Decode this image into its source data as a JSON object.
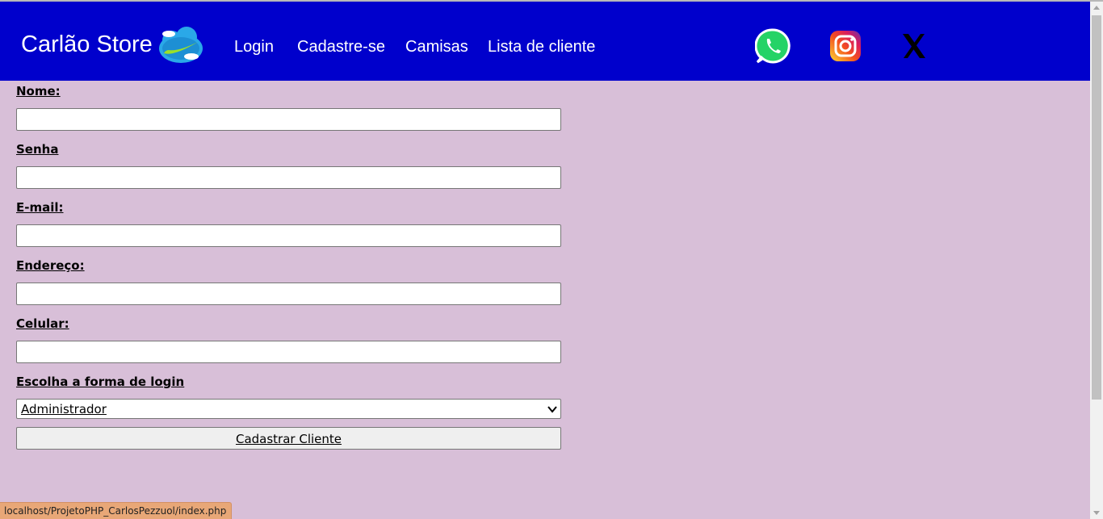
{
  "header": {
    "brand": "Carlão Store",
    "nav": [
      {
        "label": "Login"
      },
      {
        "label": "Cadastre-se"
      },
      {
        "label": "Camisas"
      },
      {
        "label": "Lista de cliente"
      }
    ],
    "social": [
      "whatsapp-icon",
      "instagram-icon",
      "x-icon"
    ]
  },
  "form": {
    "fields": [
      {
        "label": "Nome:",
        "value": ""
      },
      {
        "label": "Senha",
        "value": ""
      },
      {
        "label": "E-mail:",
        "value": ""
      },
      {
        "label": "Endereço:",
        "value": ""
      },
      {
        "label": "Celular:",
        "value": ""
      }
    ],
    "login_type_label": "Escolha a forma de login",
    "login_type_selected": "Administrador",
    "submit_label": "Cadastrar Cliente"
  },
  "status_bar": {
    "url": "localhost/ProjetoPHP_CarlosPezzuol/index.php"
  },
  "colors": {
    "navbar": "#0000cc",
    "page_background": "#d8bfd8",
    "status_bar": "#e8a777"
  }
}
